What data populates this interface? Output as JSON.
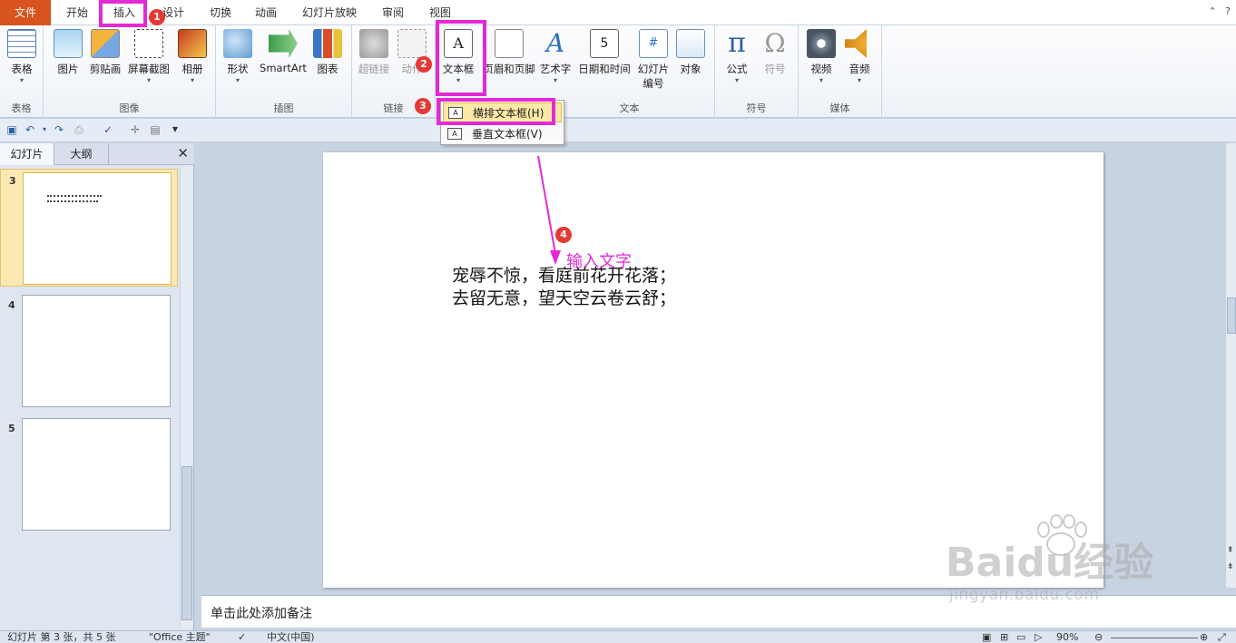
{
  "tabs": {
    "file": "文件",
    "home": "开始",
    "insert": "插入",
    "design": "设计",
    "transitions": "切换",
    "animations": "动画",
    "slideshow": "幻灯片放映",
    "review": "审阅",
    "view": "视图"
  },
  "titlebar_right": {
    "minimize_ribbon": "⌃",
    "help": "?"
  },
  "ribbon": {
    "groups": {
      "tables": "表格",
      "images": "图像",
      "illustrations": "插图",
      "links": "链接",
      "text": "文本",
      "symbols": "符号",
      "media": "媒体"
    },
    "buttons": {
      "table": "表格",
      "picture": "图片",
      "clipart": "剪贴画",
      "screenshot": "屏幕截图",
      "album": "相册",
      "shapes": "形状",
      "smartart": "SmartArt",
      "chart": "图表",
      "hyperlink": "超链接",
      "action": "动作",
      "textbox": "文本框",
      "header_footer": "页眉和页脚",
      "wordart": "艺术字",
      "datetime": "日期和时间",
      "slide_number_1": "幻灯片",
      "slide_number_2": "编号",
      "object": "对象",
      "equation": "公式",
      "symbol": "符号",
      "video": "视频",
      "audio": "音频"
    },
    "icon_glyphs": {
      "textbox": "A",
      "wordart": "A",
      "datetime": "5",
      "slidenum": "#",
      "equation": "π",
      "symbol": "Ω"
    }
  },
  "textbox_menu": {
    "horizontal": "横排文本框(H)",
    "vertical": "垂直文本框(V)"
  },
  "left_panel": {
    "tab_slides": "幻灯片",
    "tab_outline": "大纲",
    "close": "✕",
    "slides": [
      {
        "number": "3",
        "selected": true
      },
      {
        "number": "4",
        "selected": false
      },
      {
        "number": "5",
        "selected": false
      }
    ]
  },
  "slide": {
    "text": "宠辱不惊，看庭前花开花落；\n去留无意，望天空云卷云舒；"
  },
  "notes": {
    "placeholder": "单击此处添加备注"
  },
  "status_bar": {
    "slide_info": "幻灯片 第 3 张，共 5 张",
    "theme": "\"Office 主题\"",
    "language": "中文(中国)",
    "zoom": "90%"
  },
  "annotations": {
    "step1": "1",
    "step2": "2",
    "step3": "3",
    "step4": "4",
    "instruction": "输入文字",
    "highlight_color": "#e22ad6",
    "badge_color": "#e53935"
  },
  "watermark": {
    "brand": "Baidu经验",
    "url": "jingyan.baidu.com"
  },
  "colors": {
    "file_tab": "#d9531e",
    "ribbon_bg": "#eef2f8",
    "selected_slide": "#fbe9b4"
  }
}
